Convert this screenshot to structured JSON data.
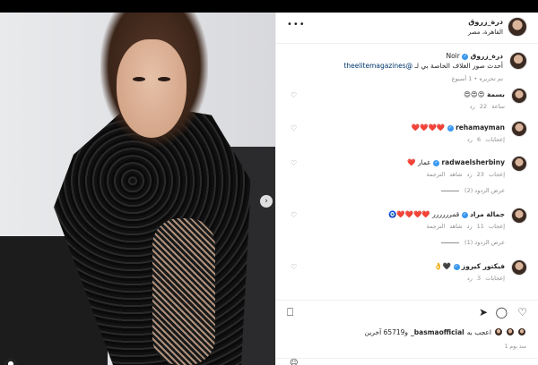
{
  "post": {
    "username": "درة_زروق",
    "location": "القاهرة، مصر",
    "more_label": "•••"
  },
  "caption": {
    "username": "درة_زروق",
    "text": "Noir",
    "line2": "أحدث صور الغلاف الخاصة بي لـ",
    "mention": "@theelitemagazines",
    "edited": "تم تحريره • 1 أسبوع"
  },
  "comments": [
    {
      "user": "بسمة",
      "text": "😍😍😍",
      "meta": "ساعة 22  رد"
    },
    {
      "user": "rehamayman",
      "text": "❤️❤️❤️❤️",
      "meta": "إعجابات 6  رد"
    },
    {
      "user": "radwaelsherbiny",
      "text": "عمار ❤️",
      "meta": "إعجاب 23  رد  شاهد الترجمة",
      "replies": "عرض الردود (2)"
    },
    {
      "user": "جمالة مراد",
      "text": "قمرررررر ❤️❤️❤️❤️🧿",
      "meta": "إعجاب 11  رد  شاهد الترجمة",
      "replies": "عرض الردود (1)"
    },
    {
      "user": "فيكتور كيروز",
      "text": "🖤👌",
      "meta": "إعجابات 3  رد"
    }
  ],
  "likes": {
    "prefix": "اعجب به",
    "user": "basmaofficial_",
    "rest": "و65719 آخرين"
  },
  "date": "منذ يوم 1",
  "colors": {
    "verified": "#3897f0",
    "link": "#00376b",
    "muted": "#8e8e8e"
  },
  "icons": [
    "heart-icon",
    "comment-icon",
    "share-icon",
    "bookmark-icon",
    "emoji-icon",
    "next-arrow-icon",
    "more-icon",
    "user-tag-icon"
  ]
}
